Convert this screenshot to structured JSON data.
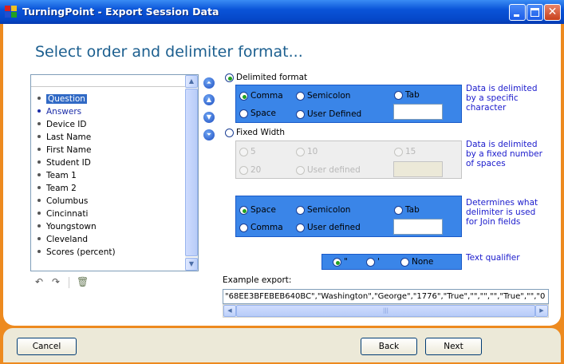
{
  "window": {
    "title": "TurningPoint - Export Session Data"
  },
  "heading": "Select order and delimiter format...",
  "fields_list": {
    "items": [
      "Question",
      "Answers",
      "Device ID",
      "Last Name",
      "First Name",
      "Student ID",
      "Team 1",
      "Team 2",
      "Columbus",
      "Cincinnati",
      "Youngstown",
      "Cleveland",
      "Scores (percent)"
    ],
    "selected": "Question"
  },
  "delimited": {
    "label": "Delimited format",
    "selected": true,
    "options": {
      "comma": "Comma",
      "semicolon": "Semicolon",
      "tab": "Tab",
      "space": "Space",
      "user_defined": "User Defined"
    },
    "selected_option": "Comma",
    "custom_value": "",
    "note": "Data is delimited by a specific character"
  },
  "fixed_width": {
    "label": "Fixed Width",
    "selected": false,
    "options": {
      "five": "5",
      "ten": "10",
      "fifteen": "15",
      "twenty": "20",
      "user_defined": "User defined"
    },
    "selected_option": "5",
    "custom_value": "",
    "note": "Data is delimited by a fixed number of spaces"
  },
  "join": {
    "options": {
      "space": "Space",
      "semicolon": "Semicolon",
      "tab": "Tab",
      "comma": "Comma",
      "user_defined": "User defined"
    },
    "selected_option": "Space",
    "custom_value": "",
    "note": "Determines what delimiter is used for Join fields"
  },
  "text_qualifier": {
    "options": {
      "double": "\"",
      "single": "'",
      "none": "None"
    },
    "selected_option": "\"",
    "label": "Text qualifier"
  },
  "example": {
    "label": "Example export:",
    "value": "\"68EE3BFEBEB640BC\",\"Washington\",\"George\",\"1776\",\"True\",\"\",\"\",\"\",\"True\",\"\",\"0"
  },
  "buttons": {
    "cancel": "Cancel",
    "back": "Back",
    "next": "Next"
  },
  "colors": {
    "frame": "#ed8a1f",
    "panel": "#3a85e8",
    "heading": "#1c5f8f",
    "note": "#1a1acc"
  }
}
